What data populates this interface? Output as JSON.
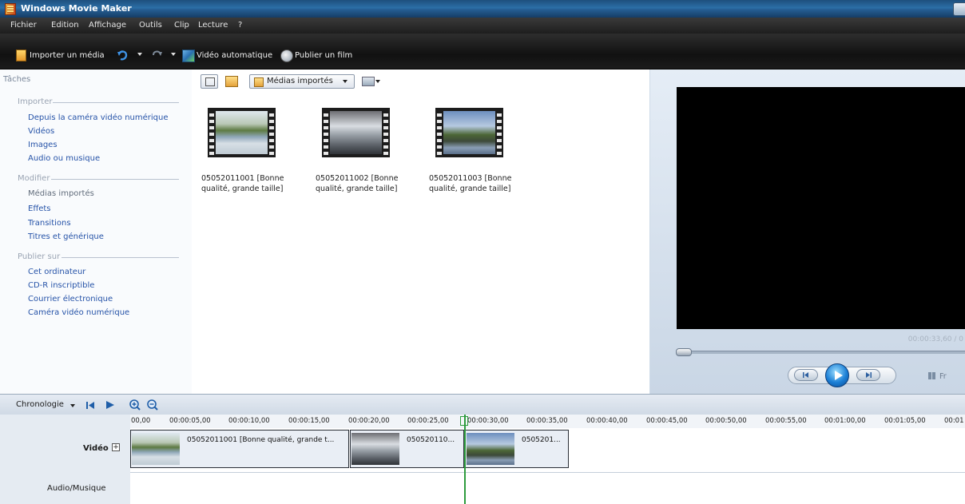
{
  "window": {
    "title": "Windows Movie Maker"
  },
  "menu": [
    "Fichier",
    "Edition",
    "Affichage",
    "Outils",
    "Clip",
    "Lecture",
    "?"
  ],
  "toolbar": {
    "import": "Importer un média",
    "auto_movie": "Vidéo automatique",
    "publish": "Publier un film"
  },
  "tasks": {
    "header": "Tâches",
    "import_section": {
      "title": "Importer",
      "items": [
        "Depuis la caméra vidéo numérique",
        "Vidéos",
        "Images",
        "Audio ou musique"
      ]
    },
    "edit_section": {
      "title": "Modifier",
      "items": [
        "Médias importés",
        "Effets",
        "Transitions",
        "Titres et générique"
      ]
    },
    "publish_section": {
      "title": "Publier sur",
      "items": [
        "Cet ordinateur",
        "CD-R inscriptible",
        "Courrier électronique",
        "Caméra vidéo numérique"
      ]
    }
  },
  "collection": {
    "dropdown": "Médias importés",
    "items": [
      {
        "line1": "05052011001 [Bonne",
        "line2": "qualité, grande taille]"
      },
      {
        "line1": "05052011002 [Bonne",
        "line2": "qualité, grande taille]"
      },
      {
        "line1": "05052011003 [Bonne",
        "line2": "qualité, grande taille]"
      }
    ]
  },
  "preview": {
    "timecode": "00:00:33,60 / 0",
    "split_label": "Fr"
  },
  "timeline": {
    "label": "Chronologie",
    "ticks": [
      "00,00",
      "00:00:05,00",
      "00:00:10,00",
      "00:00:15,00",
      "00:00:20,00",
      "00:00:25,00",
      "00:00:30,00",
      "00:00:35,00",
      "00:00:40,00",
      "00:00:45,00",
      "00:00:50,00",
      "00:00:55,00",
      "00:01:00,00",
      "00:01:05,00",
      "00:01"
    ],
    "video_track": "Vidéo",
    "audio_track": "Audio/Musique",
    "clips": [
      "05052011001 [Bonne qualité, grande t...",
      "050520110...",
      "0505201..."
    ]
  },
  "colors": {
    "link": "#2653a8",
    "playhead": "#2e9c3e",
    "toolbar": "#1b1b1b"
  }
}
